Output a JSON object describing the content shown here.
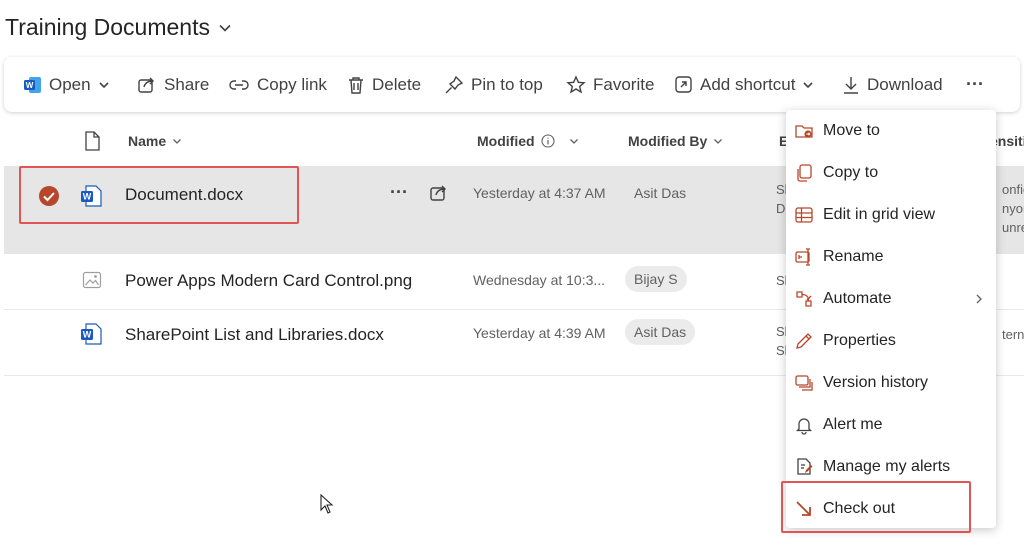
{
  "page": {
    "title": "Training Documents"
  },
  "toolbar": {
    "open": "Open",
    "share": "Share",
    "copy_link": "Copy link",
    "delete": "Delete",
    "pin_to_top": "Pin to top",
    "favorite": "Favorite",
    "add_shortcut": "Add shortcut",
    "download": "Download",
    "more": "···"
  },
  "columns": {
    "name": "Name",
    "modified": "Modified",
    "modified_by": "Modified By",
    "col4_partial": "E",
    "col5_partial": "ensiti"
  },
  "rows": [
    {
      "name": "Document.docx",
      "modified": "Yesterday at 4:37 AM",
      "modified_by": "Asit Das",
      "col4": "Sl\nD",
      "col5": "onfid\nnyon\nunres"
    },
    {
      "name": "Power Apps Modern Card Control.png",
      "modified": "Wednesday at 10:3...",
      "modified_by": "Bijay S",
      "col4": "Sl",
      "col5": ""
    },
    {
      "name": "SharePoint List and Libraries.docx",
      "modified": "Yesterday at 4:39 AM",
      "modified_by": "Asit Das",
      "col4": "Sl\nSl",
      "col5": "terna"
    }
  ],
  "row_more": "···",
  "context_menu": {
    "items": [
      {
        "label": "Move to",
        "icon": "move-to-icon"
      },
      {
        "label": "Copy to",
        "icon": "copy-to-icon"
      },
      {
        "label": "Edit in grid view",
        "icon": "grid-view-icon"
      },
      {
        "label": "Rename",
        "icon": "rename-icon"
      },
      {
        "label": "Automate",
        "icon": "automate-icon"
      },
      {
        "label": "Properties",
        "icon": "properties-icon"
      },
      {
        "label": "Version history",
        "icon": "version-history-icon"
      },
      {
        "label": "Alert me",
        "icon": "bell-icon"
      },
      {
        "label": "Manage my alerts",
        "icon": "manage-alerts-icon"
      },
      {
        "label": "Check out",
        "icon": "check-out-icon"
      }
    ]
  },
  "colors": {
    "accent": "#b7472a",
    "word_blue": "#185abd",
    "highlight_box": "#e25555",
    "selected_row": "#e6e6e6"
  }
}
